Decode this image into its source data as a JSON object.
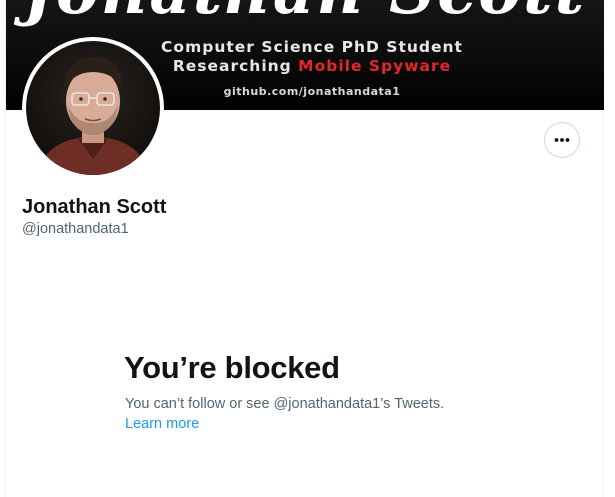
{
  "banner": {
    "script_text": "Jonathan Scott",
    "line1": "Computer Science PhD Student",
    "line2_prefix": "Researching ",
    "line2_highlight": "Mobile Spyware",
    "link": "github.com/jonathandata1"
  },
  "profile": {
    "display_name": "Jonathan Scott",
    "handle": "@jonathandata1",
    "more_icon": "more-horizontal-icon"
  },
  "blocked": {
    "title": "You’re blocked",
    "message": "You can’t follow or see @jonathandata1’s Tweets.",
    "learn_more": "Learn more"
  },
  "colors": {
    "link": "#1d9bf0",
    "secondary_text": "#536471",
    "primary_text": "#0f1419",
    "banner_accent": "#e0282b"
  }
}
